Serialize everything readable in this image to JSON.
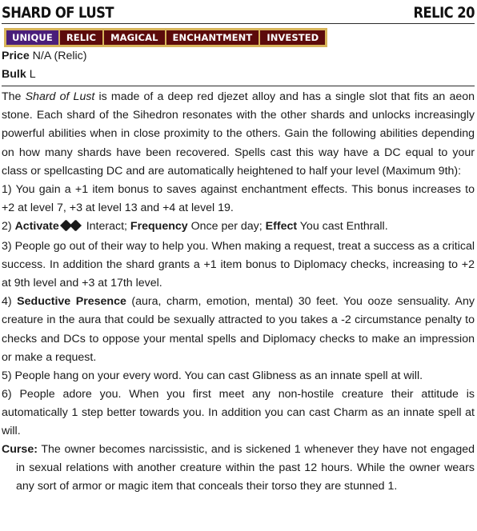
{
  "item": {
    "title": "SHARD OF LUST",
    "level": "RELIC 20",
    "traits": [
      "UNIQUE",
      "RELIC",
      "MAGICAL",
      "ENCHANTMENT",
      "INVESTED"
    ],
    "price_label": "Price",
    "price_value": " N/A (Relic)",
    "bulk_label": "Bulk",
    "bulk_value": " L"
  },
  "body": {
    "intro_1": "The ",
    "intro_name": "Shard of Lust",
    "intro_2": " is made of a deep red djezet alloy and has a single slot that fits an aeon stone. Each shard of the Sihedron resonates with the other shards and unlocks increasingly powerful abilities when in close proximity to the others. Gain the following abilities depending on how many shards have been recovered. Spells cast this way have a DC equal to your class or spellcasting DC and are automatically heightened to half your level (Maximum 9th):",
    "ab1": "1) You gain a +1 item bonus to saves against enchantment effects. This bonus increases to +2 at level 7, +3 at level 13 and +4 at level 19.",
    "ab2_num": "2) ",
    "ab2_activate": "Activate",
    "ab2_interact": " Interact; ",
    "ab2_freq_label": "Frequency",
    "ab2_freq": " Once per day; ",
    "ab2_effect_label": "Effect",
    "ab2_effect": " You cast Enthrall.",
    "ab3": "3) People go out of their way to help you. When making a request, treat a success as a critical success. In addition the shard grants a +1 item bonus to Diplomacy checks, increasing to +2 at 9th level and +3 at 17th level.",
    "ab4_num": "4) ",
    "ab4_name": "Seductive Presence",
    "ab4_text": " (aura, charm, emotion, mental) 30 feet. You ooze sensuality. Any creature in the aura that could be sexually attracted to you takes a -2 circumstance penalty to checks and DCs to oppose your mental spells and Diplomacy checks to make an impression or make a request.",
    "ab5": "5) People hang on your every word. You can cast Glibness as an innate spell at will.",
    "ab6": "6) People adore you. When you first meet any non-hostile creature their attitude is automatically 1 step better towards you. In addition you can cast Charm as an innate spell at will.",
    "curse_label": "Curse:",
    "curse_text": " The owner becomes narcissistic, and is sickened 1 whenever they have not engaged in sexual relations with another creature within the past 12 hours. While the owner wears any sort of armor or magic item that conceals their torso they are stunned 1."
  },
  "icons": {
    "action": "two-action-icon"
  },
  "colors": {
    "trait_bg": "#5c0b0b",
    "unique_bg": "#4a1e7a",
    "trait_border": "#d7b45a"
  }
}
